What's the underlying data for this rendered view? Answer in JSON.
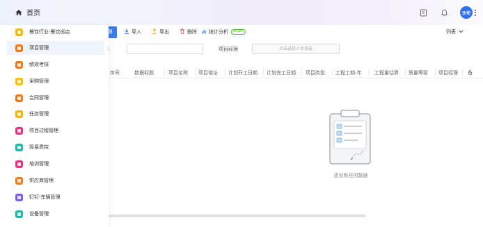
{
  "topbar": {
    "home_label": "首页",
    "avatar_text": "沙司",
    "icons": [
      "home-icon",
      "calendar-icon",
      "bell-icon",
      "more-icon"
    ]
  },
  "toolbar": {
    "primary_label": "理",
    "import_label": "导入",
    "export_label": "导出",
    "delete_label": "删除",
    "stats_label": "统计分析",
    "new_badge": "NEW新",
    "listview_label": "列表",
    "colors": {
      "primary": "#3a7af2",
      "import": "#2f6ff2",
      "export": "#f0a400",
      "delete": "#e84d4d",
      "stats": "#6aa0f0"
    }
  },
  "filters": {
    "left_label": "称",
    "manager_label": "项目经理",
    "person_placeholder": "点击选择人员添选"
  },
  "table": {
    "columns": [
      "序号",
      "数据标题",
      "项目名称",
      "项目地址",
      "计划开工日期",
      "计划完工日期",
      "项目类型",
      "工程工期-年",
      "工程量估算",
      "质量等级",
      "项目经理",
      "备"
    ]
  },
  "empty": {
    "text": "还没有任何数据"
  },
  "sidebar": {
    "items": [
      {
        "label": "餐饮行业-餐饮巡店",
        "color": "#f7b500",
        "active": false
      },
      {
        "label": "项目管理",
        "color": "#f07a18",
        "active": true
      },
      {
        "label": "绩效考核",
        "color": "#f07a18",
        "active": false
      },
      {
        "label": "采购管理",
        "color": "#f7c200",
        "active": false
      },
      {
        "label": "合同管理",
        "color": "#f07a18",
        "active": false
      },
      {
        "label": "任务管理",
        "color": "#f7b500",
        "active": false
      },
      {
        "label": "项目过程管理",
        "color": "#e8317c",
        "active": false
      },
      {
        "label": "简易质控",
        "color": "#19b9a6",
        "active": false
      },
      {
        "label": "培训管理",
        "color": "#e8317c",
        "active": false
      },
      {
        "label": "供应商管理",
        "color": "#f07a18",
        "active": false
      },
      {
        "label": "钉钉-车辆管理",
        "color": "#7b5cf0",
        "active": false
      },
      {
        "label": "设备管理",
        "color": "#19b9a6",
        "active": false
      }
    ]
  }
}
